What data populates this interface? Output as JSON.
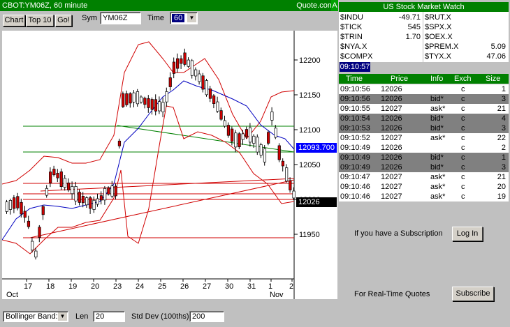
{
  "title_left": "CBOT:YM06Z, 60 minute",
  "title_right": "Quote.com",
  "title_a": "A",
  "toolbar": {
    "chart": "Chart",
    "top10": "Top 10",
    "go": "Go!",
    "sym_label": "Sym",
    "sym_value": "YM06Z",
    "time_label": "Time",
    "time_value": "60"
  },
  "price_axis": [
    "12200",
    "12150",
    "12100",
    "12050",
    "12000",
    "11950"
  ],
  "price_tags": {
    "blue": "12093.700",
    "black": "12026"
  },
  "date_axis": [
    "17",
    "18",
    "19",
    "20",
    "23",
    "24",
    "25",
    "26",
    "27",
    "30",
    "31",
    "1",
    "2"
  ],
  "month_axis": {
    "oct": "Oct",
    "nov": "Nov"
  },
  "bottom": {
    "study": "Bollinger Band:",
    "len_label": "Len",
    "len_value": "20",
    "std_label": "Std Dev (100ths)",
    "std_value": "200"
  },
  "watch": {
    "title": "US Stock Market Watch",
    "rows": [
      {
        "s1": "$INDU",
        "v1": "-49.71",
        "s2": "$RUT.X",
        "v2": ""
      },
      {
        "s1": "$TICK",
        "v1": "545",
        "s2": "$SPX.X",
        "v2": ""
      },
      {
        "s1": "$TRIN",
        "v1": "1.70",
        "s2": "$OEX.X",
        "v2": ""
      },
      {
        "s1": "$NYA.X",
        "v1": "",
        "s2": "$PREM.X",
        "v2": "5.09"
      },
      {
        "s1": "$COMPX",
        "v1": "",
        "s2": "$TYX.X",
        "v2": "47.06"
      }
    ]
  },
  "clock": "09:10:57",
  "trades": {
    "headers": {
      "time": "Time",
      "price": "Price",
      "info": "Info",
      "exch": "Exch",
      "size": "Size"
    },
    "rows": [
      {
        "time": "09:10:56",
        "price": "12026",
        "info": "",
        "exch": "c",
        "size": "1",
        "shade": false
      },
      {
        "time": "09:10:56",
        "price": "12026",
        "info": "bid*",
        "exch": "c",
        "size": "3",
        "shade": true
      },
      {
        "time": "09:10:55",
        "price": "12027",
        "info": "ask*",
        "exch": "c",
        "size": "21",
        "shade": false
      },
      {
        "time": "09:10:54",
        "price": "12026",
        "info": "bid*",
        "exch": "c",
        "size": "4",
        "shade": true
      },
      {
        "time": "09:10:53",
        "price": "12026",
        "info": "bid*",
        "exch": "c",
        "size": "3",
        "shade": true
      },
      {
        "time": "09:10:52",
        "price": "12027",
        "info": "ask*",
        "exch": "c",
        "size": "22",
        "shade": false
      },
      {
        "time": "09:10:49",
        "price": "12026",
        "info": "",
        "exch": "c",
        "size": "2",
        "shade": false
      },
      {
        "time": "09:10:49",
        "price": "12026",
        "info": "bid*",
        "exch": "c",
        "size": "1",
        "shade": true
      },
      {
        "time": "09:10:49",
        "price": "12026",
        "info": "bid*",
        "exch": "c",
        "size": "3",
        "shade": true
      },
      {
        "time": "09:10:47",
        "price": "12027",
        "info": "ask*",
        "exch": "c",
        "size": "21",
        "shade": false
      },
      {
        "time": "09:10:46",
        "price": "12027",
        "info": "ask*",
        "exch": "c",
        "size": "20",
        "shade": false
      },
      {
        "time": "09:10:46",
        "price": "12027",
        "info": "ask*",
        "exch": "c",
        "size": "19",
        "shade": false
      }
    ]
  },
  "subscription": {
    "text": "If you have a Subscription",
    "button": "Log In"
  },
  "realtime": {
    "text": "For Real-Time Quotes",
    "button": "Subscribe"
  }
}
